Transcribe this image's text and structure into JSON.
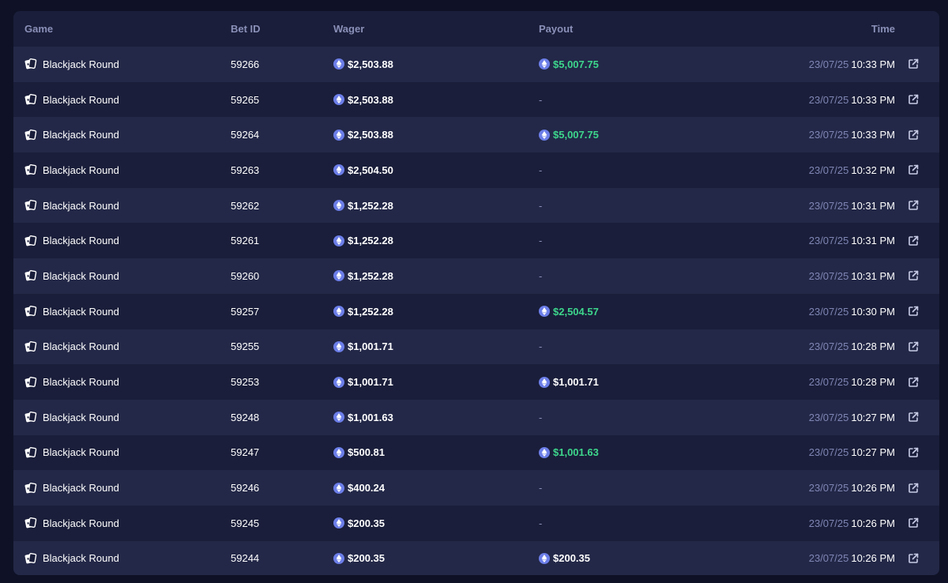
{
  "header": {
    "game": "Game",
    "bet_id": "Bet ID",
    "wager": "Wager",
    "payout": "Payout",
    "time": "Time"
  },
  "colors": {
    "win": "#3dd68c",
    "eth": "#6c7ee8",
    "muted": "#8a90b8"
  },
  "rows": [
    {
      "game": "Blackjack Round",
      "bet_id": "59266",
      "wager": "$2,503.88",
      "payout": "$5,007.75",
      "payout_win": true,
      "date": "23/07/25",
      "time": "10:33 PM"
    },
    {
      "game": "Blackjack Round",
      "bet_id": "59265",
      "wager": "$2,503.88",
      "payout": "-",
      "payout_win": false,
      "date": "23/07/25",
      "time": "10:33 PM"
    },
    {
      "game": "Blackjack Round",
      "bet_id": "59264",
      "wager": "$2,503.88",
      "payout": "$5,007.75",
      "payout_win": true,
      "date": "23/07/25",
      "time": "10:33 PM"
    },
    {
      "game": "Blackjack Round",
      "bet_id": "59263",
      "wager": "$2,504.50",
      "payout": "-",
      "payout_win": false,
      "date": "23/07/25",
      "time": "10:32 PM"
    },
    {
      "game": "Blackjack Round",
      "bet_id": "59262",
      "wager": "$1,252.28",
      "payout": "-",
      "payout_win": false,
      "date": "23/07/25",
      "time": "10:31 PM"
    },
    {
      "game": "Blackjack Round",
      "bet_id": "59261",
      "wager": "$1,252.28",
      "payout": "-",
      "payout_win": false,
      "date": "23/07/25",
      "time": "10:31 PM"
    },
    {
      "game": "Blackjack Round",
      "bet_id": "59260",
      "wager": "$1,252.28",
      "payout": "-",
      "payout_win": false,
      "date": "23/07/25",
      "time": "10:31 PM"
    },
    {
      "game": "Blackjack Round",
      "bet_id": "59257",
      "wager": "$1,252.28",
      "payout": "$2,504.57",
      "payout_win": true,
      "date": "23/07/25",
      "time": "10:30 PM"
    },
    {
      "game": "Blackjack Round",
      "bet_id": "59255",
      "wager": "$1,001.71",
      "payout": "-",
      "payout_win": false,
      "date": "23/07/25",
      "time": "10:28 PM"
    },
    {
      "game": "Blackjack Round",
      "bet_id": "59253",
      "wager": "$1,001.71",
      "payout": "$1,001.71",
      "payout_win": false,
      "date": "23/07/25",
      "time": "10:28 PM"
    },
    {
      "game": "Blackjack Round",
      "bet_id": "59248",
      "wager": "$1,001.63",
      "payout": "-",
      "payout_win": false,
      "date": "23/07/25",
      "time": "10:27 PM"
    },
    {
      "game": "Blackjack Round",
      "bet_id": "59247",
      "wager": "$500.81",
      "payout": "$1,001.63",
      "payout_win": true,
      "date": "23/07/25",
      "time": "10:27 PM"
    },
    {
      "game": "Blackjack Round",
      "bet_id": "59246",
      "wager": "$400.24",
      "payout": "-",
      "payout_win": false,
      "date": "23/07/25",
      "time": "10:26 PM"
    },
    {
      "game": "Blackjack Round",
      "bet_id": "59245",
      "wager": "$200.35",
      "payout": "-",
      "payout_win": false,
      "date": "23/07/25",
      "time": "10:26 PM"
    },
    {
      "game": "Blackjack Round",
      "bet_id": "59244",
      "wager": "$200.35",
      "payout": "$200.35",
      "payout_win": false,
      "date": "23/07/25",
      "time": "10:26 PM"
    }
  ]
}
